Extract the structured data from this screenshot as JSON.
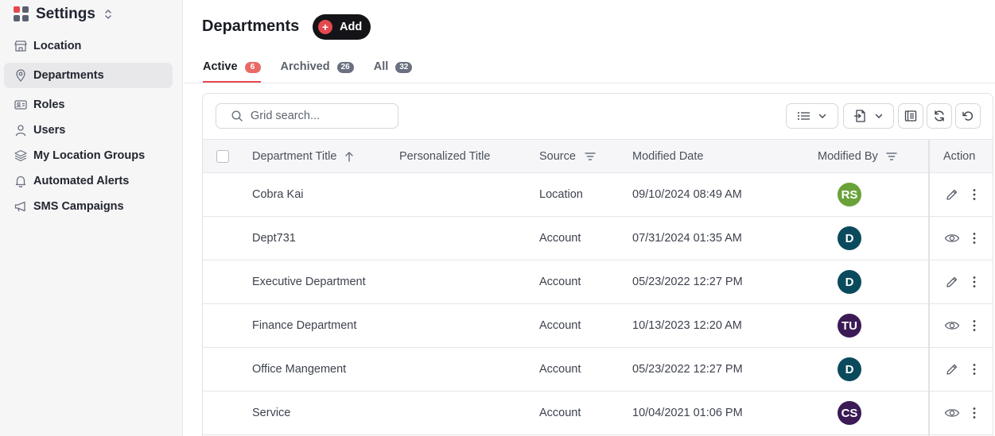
{
  "sidebar": {
    "app_title": "Settings",
    "items": [
      {
        "label": "Location",
        "icon": "store-icon"
      },
      {
        "label": "Departments",
        "icon": "map-pin-icon",
        "active": true
      },
      {
        "label": "Roles",
        "icon": "id-card-icon"
      },
      {
        "label": "Users",
        "icon": "user-icon"
      },
      {
        "label": "My Location Groups",
        "icon": "layers-icon"
      },
      {
        "label": "Automated Alerts",
        "icon": "bell-icon"
      },
      {
        "label": "SMS Campaigns",
        "icon": "megaphone-icon"
      }
    ]
  },
  "header": {
    "title": "Departments",
    "add_label": "Add"
  },
  "tabs": [
    {
      "label": "Active",
      "count": "6",
      "active": true
    },
    {
      "label": "Archived",
      "count": "26"
    },
    {
      "label": "All",
      "count": "32"
    }
  ],
  "grid": {
    "search_placeholder": "Grid search...",
    "columns": {
      "title": "Department Title",
      "personalized": "Personalized Title",
      "source": "Source",
      "modified_date": "Modified Date",
      "modified_by": "Modified By",
      "action": "Action"
    },
    "rows": [
      {
        "title": "Cobra Kai",
        "source": "Location",
        "modified_date": "09/10/2024 08:49 AM",
        "initials": "RS",
        "avatar_color": "#6aa23a",
        "action": "edit"
      },
      {
        "title": "Dept731",
        "source": "Account",
        "modified_date": "07/31/2024 01:35 AM",
        "initials": "D",
        "avatar_color": "#0b4a5c",
        "action": "view"
      },
      {
        "title": "Executive Department",
        "source": "Account",
        "modified_date": "05/23/2022 12:27 PM",
        "initials": "D",
        "avatar_color": "#0b4a5c",
        "action": "edit"
      },
      {
        "title": "Finance Department",
        "source": "Account",
        "modified_date": "10/13/2023 12:20 AM",
        "initials": "TU",
        "avatar_color": "#3b1a55",
        "action": "view"
      },
      {
        "title": "Office Mangement",
        "source": "Account",
        "modified_date": "05/23/2022 12:27 PM",
        "initials": "D",
        "avatar_color": "#0b4a5c",
        "action": "edit"
      },
      {
        "title": "Service",
        "source": "Account",
        "modified_date": "10/04/2021 01:06 PM",
        "initials": "CS",
        "avatar_color": "#3b1a55",
        "action": "view"
      }
    ]
  }
}
